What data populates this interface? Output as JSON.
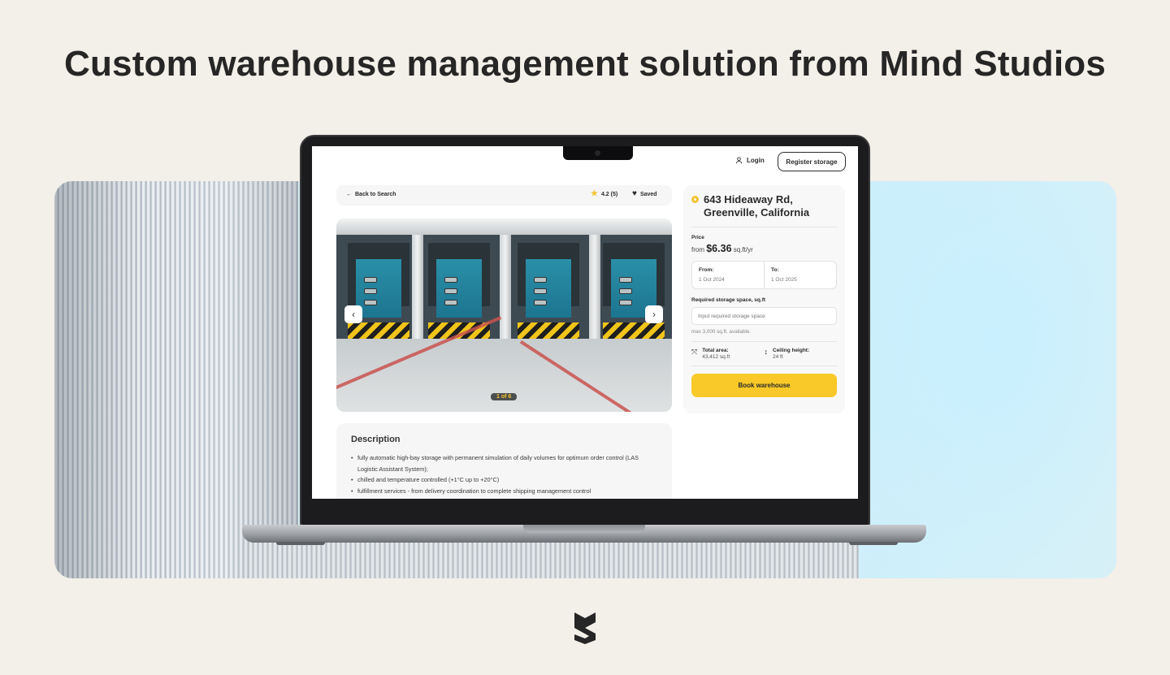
{
  "headline": "Custom warehouse management solution from Mind Studios",
  "colors": {
    "accent": "#f8c928",
    "background": "#f3efe9",
    "star": "#f4c430"
  },
  "app": {
    "header": {
      "login_label": "Login",
      "register_label": "Register storage"
    },
    "breadcrumb": {
      "back_label": "Back to Search",
      "rating": "4.2 (5)",
      "saved_label": "Saved"
    },
    "gallery": {
      "counter": "1 of 6",
      "prev_icon": "chevron-left-icon",
      "next_icon": "chevron-right-icon"
    },
    "description": {
      "title": "Description",
      "items": [
        "fully automatic high-bay storage with permanent simulation of daily volumes for optimum order control (LAS Logistic Assistant System);",
        "chilled and temperature controlled (+1°C up to +20°C)",
        "fulfillment services - from delivery coordination to complete shipping management control"
      ]
    },
    "booking": {
      "address_line1": "643 Hideaway Rd,",
      "address_line2": "Greenville, California",
      "price_label": "Price",
      "price_prefix": "from",
      "price_value": "$6.36",
      "price_unit": "sq.ft/yr",
      "from_label": "From:",
      "from_value": "1 Oct 2024",
      "to_label": "To:",
      "to_value": "1 Oct 2025",
      "space_label": "Required storage space, sq.ft",
      "space_placeholder": "Input required storage space",
      "space_hint": "max 3,000 sq.ft. available.",
      "total_area_label": "Total area:",
      "total_area_value": "43,412 sq.ft",
      "ceiling_label": "Ceiling height:",
      "ceiling_value": "24 ft",
      "book_label": "Book warehouse"
    }
  }
}
